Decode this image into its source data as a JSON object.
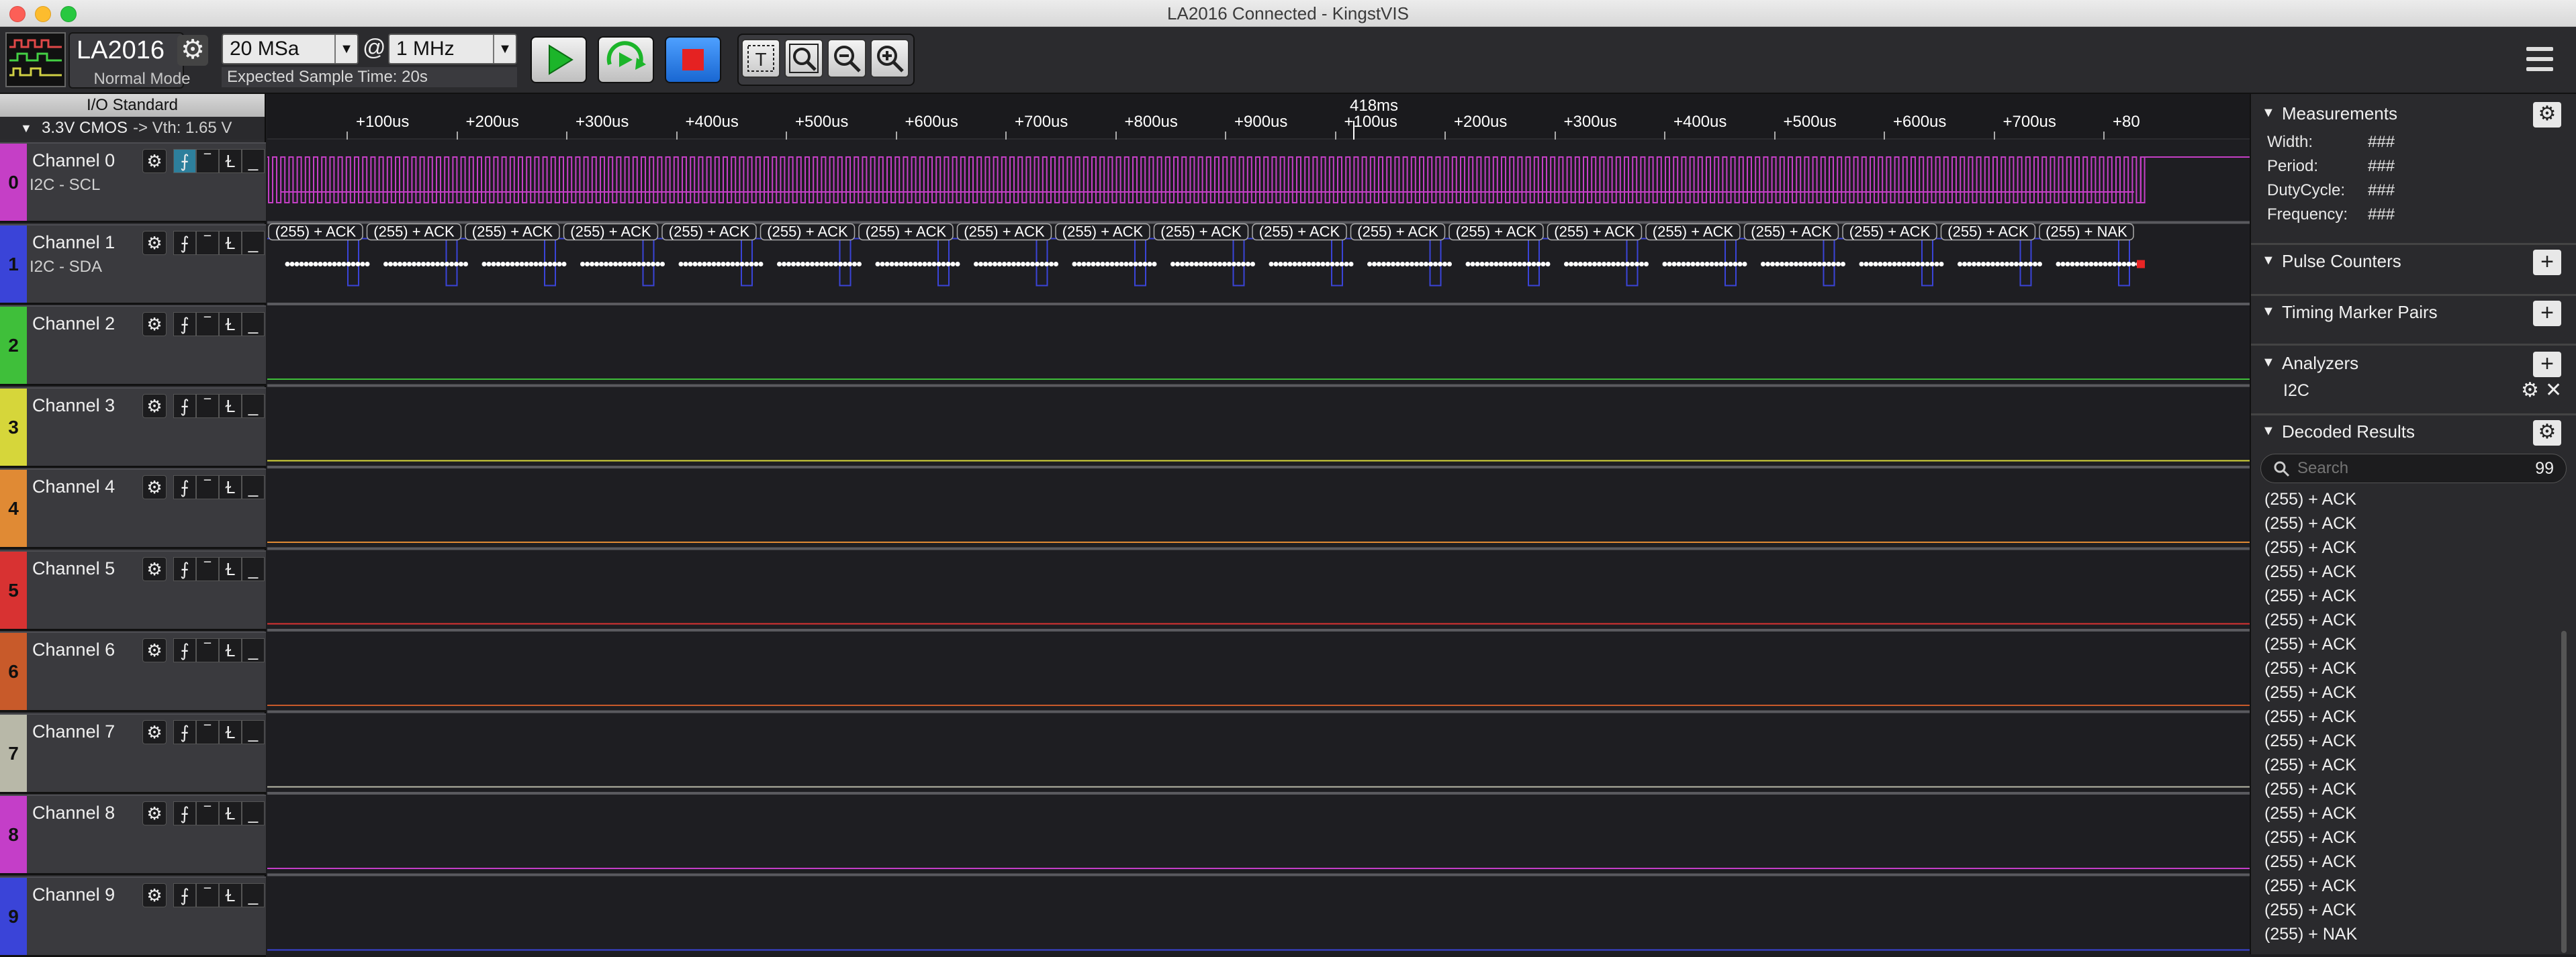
{
  "window": {
    "title": "LA2016 Connected - KingstVIS"
  },
  "toolbar": {
    "device": "LA2016",
    "mode": "Normal Mode",
    "sample_depth": "20 MSa",
    "at": "@",
    "sample_rate": "1 MHz",
    "expected_time": "Expected Sample Time: 20s"
  },
  "io": {
    "header": "I/O Standard",
    "value": "3.3V CMOS",
    "vth": "-> Vth: 1.65 V"
  },
  "channels": [
    {
      "num": "0",
      "name": "Channel 0",
      "sub": "I2C - SCL",
      "color": "#c53fc6"
    },
    {
      "num": "1",
      "name": "Channel 1",
      "sub": "I2C - SDA",
      "color": "#3a44d8"
    },
    {
      "num": "2",
      "name": "Channel 2",
      "sub": "",
      "color": "#3fbf3a"
    },
    {
      "num": "3",
      "name": "Channel 3",
      "sub": "",
      "color": "#d6d63a"
    },
    {
      "num": "4",
      "name": "Channel 4",
      "sub": "",
      "color": "#e08a34"
    },
    {
      "num": "5",
      "name": "Channel 5",
      "sub": "",
      "color": "#d83232"
    },
    {
      "num": "6",
      "name": "Channel 6",
      "sub": "",
      "color": "#c85a2a"
    },
    {
      "num": "7",
      "name": "Channel 7",
      "sub": "",
      "color": "#b8b8a8"
    },
    {
      "num": "8",
      "name": "Channel 8",
      "sub": "",
      "color": "#c43ec8"
    },
    {
      "num": "9",
      "name": "Channel 9",
      "sub": "",
      "color": "#3a44d8"
    }
  ],
  "ruler": {
    "center": "418ms",
    "ticks": [
      "+100us",
      "+200us",
      "+300us",
      "+400us",
      "+500us",
      "+600us",
      "+700us",
      "+800us",
      "+900us",
      "+100us",
      "+200us",
      "+300us",
      "+400us",
      "+500us",
      "+600us",
      "+700us",
      "+80"
    ]
  },
  "sda_labels": [
    "(255) + ACK",
    "(255) + ACK",
    "(255) + ACK",
    "(255) + ACK",
    "(255) + ACK",
    "(255) + ACK",
    "(255) + ACK",
    "(255) + ACK",
    "(255) + ACK",
    "(255) + ACK",
    "(255) + ACK",
    "(255) + ACK",
    "(255) + ACK",
    "(255) + ACK",
    "(255) + ACK",
    "(255) + ACK",
    "(255) + ACK",
    "(255) + ACK",
    "(255) + NAK"
  ],
  "measurements": {
    "title": "Measurements",
    "rows": [
      {
        "label": "Width:",
        "value": "###"
      },
      {
        "label": "Period:",
        "value": "###"
      },
      {
        "label": "DutyCycle:",
        "value": "###"
      },
      {
        "label": "Frequency:",
        "value": "###"
      }
    ]
  },
  "pulse_counters": {
    "title": "Pulse Counters"
  },
  "timing_markers": {
    "title": "Timing Marker Pairs"
  },
  "analyzers": {
    "title": "Analyzers",
    "items": [
      "I2C"
    ]
  },
  "decoded": {
    "title": "Decoded Results",
    "search_placeholder": "Search",
    "count": "99",
    "items": [
      "(255) + ACK",
      "(255) + ACK",
      "(255) + ACK",
      "(255) + ACK",
      "(255) + ACK",
      "(255) + ACK",
      "(255) + ACK",
      "(255) + ACK",
      "(255) + ACK",
      "(255) + ACK",
      "(255) + ACK",
      "(255) + ACK",
      "(255) + ACK",
      "(255) + ACK",
      "(255) + ACK",
      "(255) + ACK",
      "(255) + ACK",
      "(255) + ACK",
      "(255) + NAK"
    ]
  }
}
